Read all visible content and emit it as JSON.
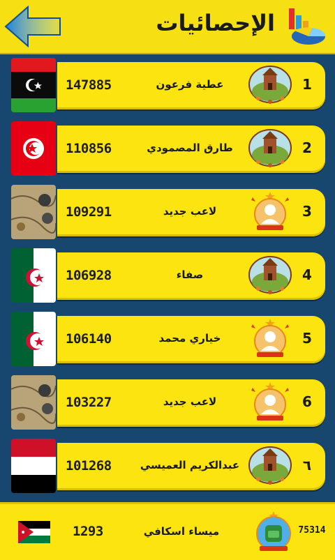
{
  "header": {
    "title": "الإحصائيات",
    "back_icon": "back-arrow-icon",
    "stats_icon": "statistics-chart-icon"
  },
  "colors": {
    "background": "#17466f",
    "card": "#fbe40f",
    "back_arrow": "#1f82e0"
  },
  "players": [
    {
      "rank": "1",
      "name": "عطية فرعون",
      "score": "147885",
      "flag": "libya",
      "avatar": "castle-emblem"
    },
    {
      "rank": "2",
      "name": "طارق المصمودي",
      "score": "110856",
      "flag": "tunisia",
      "avatar": "castle-emblem"
    },
    {
      "rank": "3",
      "name": "لاعب جديد",
      "score": "109291",
      "flag": "map",
      "avatar": "player-badge"
    },
    {
      "rank": "4",
      "name": "صفاء",
      "score": "106928",
      "flag": "algeria",
      "avatar": "castle-emblem"
    },
    {
      "rank": "5",
      "name": "خياري محمد",
      "score": "106140",
      "flag": "algeria",
      "avatar": "player-badge"
    },
    {
      "rank": "6",
      "name": "لاعب جديد",
      "score": "103227",
      "flag": "map",
      "avatar": "player-badge"
    },
    {
      "rank": "٦",
      "name": "عبدالكريم العميسي",
      "score": "101268",
      "flag": "yemen",
      "avatar": "castle-emblem"
    }
  ],
  "current_player": {
    "rank": "75314",
    "name": "ميساء اسكافي",
    "score": "1293",
    "flag": "jordan",
    "avatar": "backpack-badge"
  }
}
